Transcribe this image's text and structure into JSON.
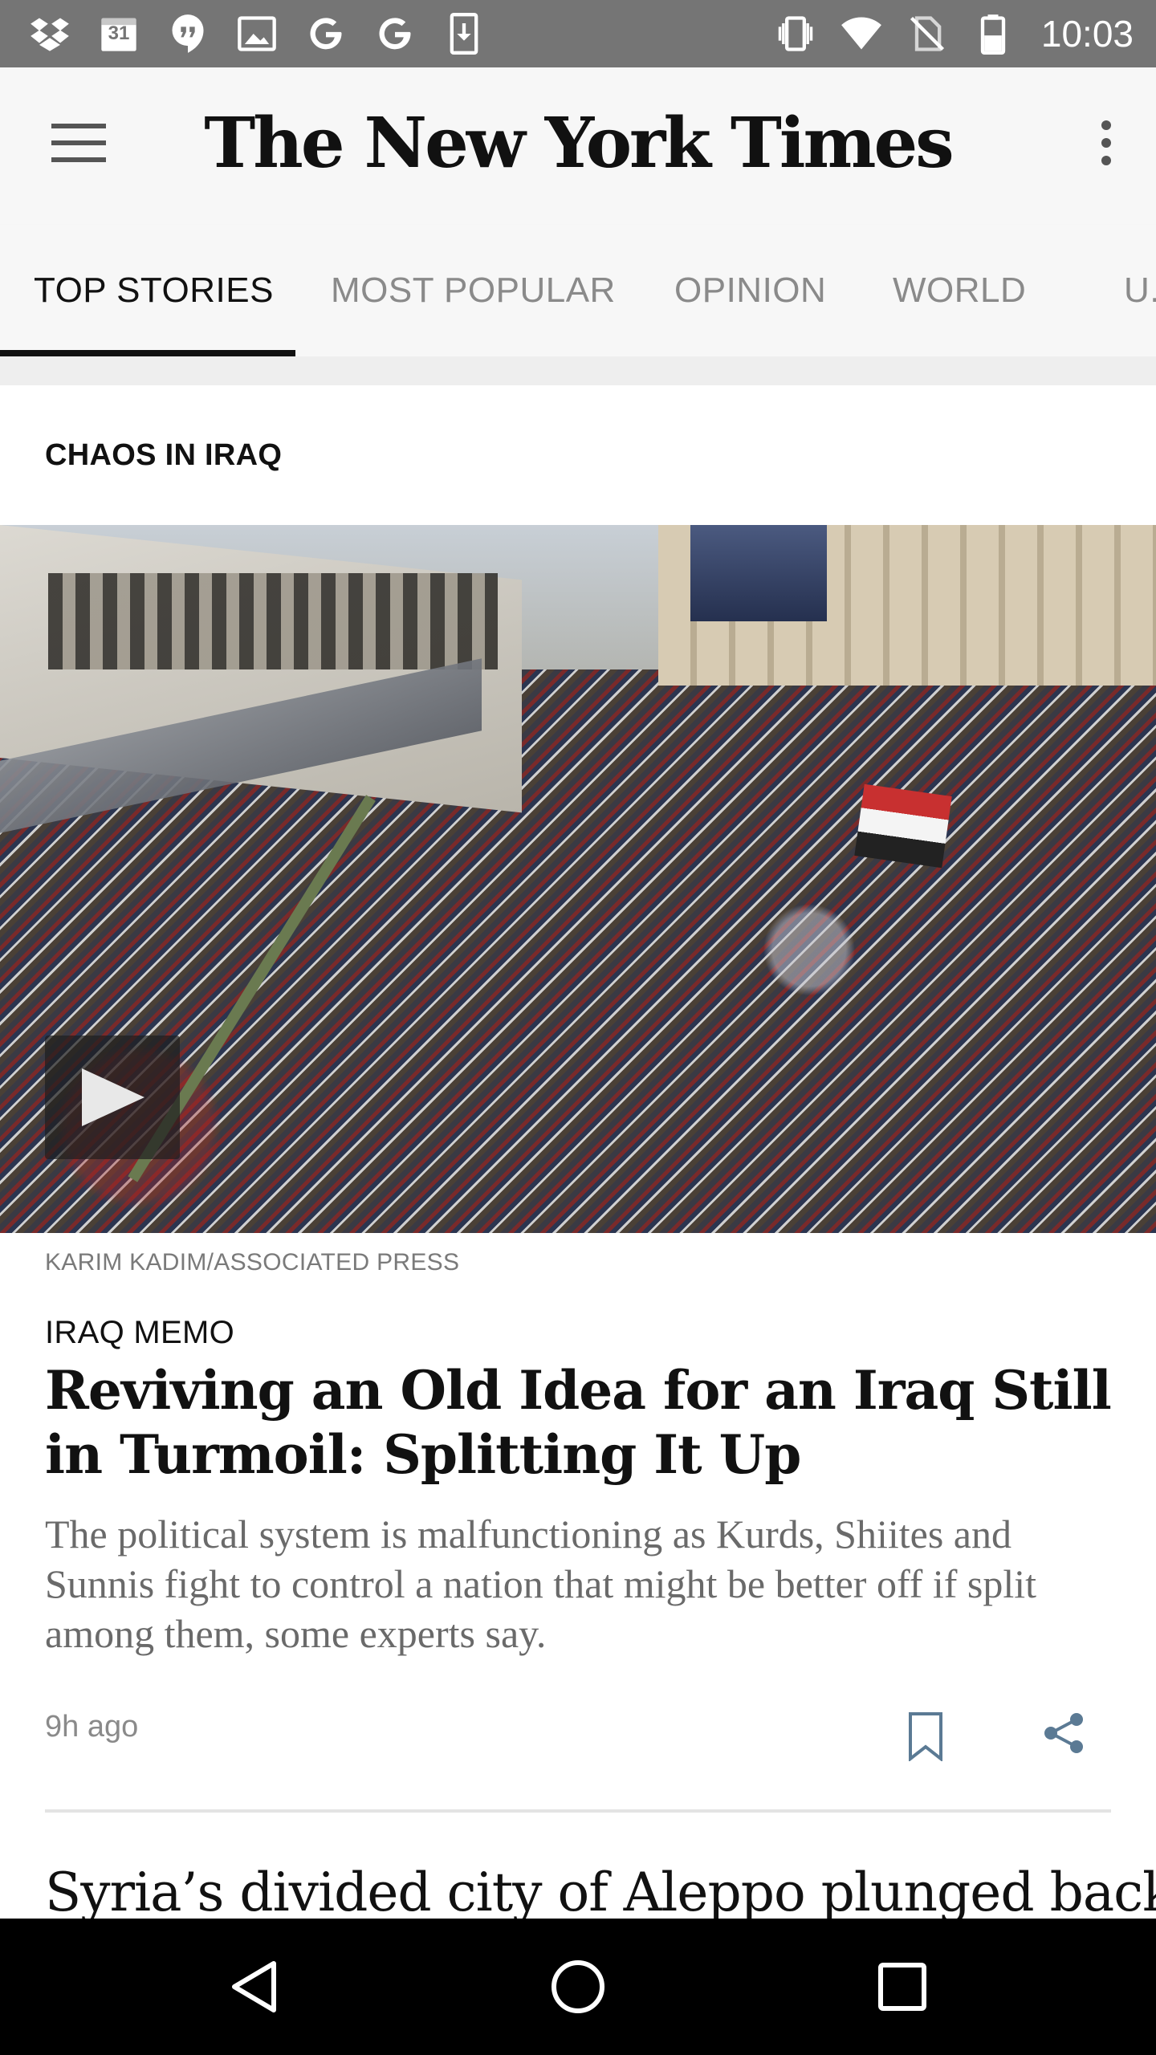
{
  "status_bar": {
    "time": "10:03",
    "left_icons": [
      "dropbox-icon",
      "calendar-icon",
      "hangouts-icon",
      "image-icon",
      "google-icon",
      "google-icon",
      "download-icon"
    ],
    "right_icons": [
      "vibrate-icon",
      "wifi-icon",
      "no-sim-icon",
      "battery-icon"
    ],
    "calendar_day": "31"
  },
  "app_bar": {
    "logo_text": "The New York Times",
    "menu_icon": "hamburger-menu-icon",
    "more_icon": "more-vert-icon"
  },
  "tabs": [
    {
      "label": "TOP STORIES",
      "active": true
    },
    {
      "label": "MOST POPULAR",
      "active": false
    },
    {
      "label": "OPINION",
      "active": false
    },
    {
      "label": "WORLD",
      "active": false
    },
    {
      "label": "U.",
      "active": false
    }
  ],
  "section": {
    "label": "CHAOS IN IRAQ"
  },
  "article": {
    "photo_credit": "KARIM KADIM/ASSOCIATED PRESS",
    "kicker": "IRAQ MEMO",
    "headline": "Reviving an Old Idea for an Iraq Still in Turmoil: Splitting It Up",
    "summary": "The political system is malfunctioning as Kurds, Shiites and Sunnis fight to control a nation that might be better off if split among them, some experts say.",
    "timestamp": "9h ago",
    "has_video": true,
    "accent_color": "#5b7a94"
  },
  "next_article": {
    "headline": "Syria’s divided city of Aleppo plunged back"
  },
  "nav_bar": {
    "back_icon": "back-triangle-icon",
    "home_icon": "home-circle-icon",
    "recents_icon": "recents-square-icon"
  }
}
